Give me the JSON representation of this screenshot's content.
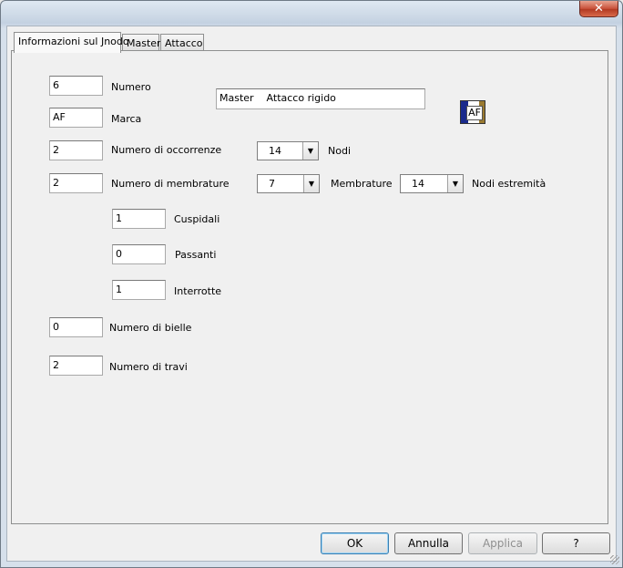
{
  "tabs": [
    "Informazioni sul Jnodo",
    "Master",
    "Attacco"
  ],
  "close_label": "✕",
  "fields": {
    "numero": {
      "value": "6",
      "label": "Numero"
    },
    "marca": {
      "value": "AF",
      "label": "Marca"
    },
    "occorrenze": {
      "value": "2",
      "label": "Numero di occorrenze"
    },
    "membrature": {
      "value": "2",
      "label": "Numero di membrature"
    },
    "cuspidali": {
      "value": "1",
      "label": "Cuspidali"
    },
    "passanti": {
      "value": "0",
      "label": "Passanti"
    },
    "interrotte": {
      "value": "1",
      "label": "Interrotte"
    },
    "bielle": {
      "value": "0",
      "label": "Numero di bielle"
    },
    "travi": {
      "value": "2",
      "label": "Numero di travi"
    }
  },
  "description": "Master    Attacco rigido",
  "icon_text": "AF",
  "combos": {
    "nodi": {
      "value": "14",
      "label": "Nodi"
    },
    "membrature": {
      "value": "7",
      "label": "Membrature"
    },
    "nodi_estremita": {
      "value": "14",
      "label": "Nodi estremità"
    }
  },
  "buttons": {
    "ok": "OK",
    "annulla": "Annulla",
    "applica": "Applica",
    "help": "?"
  },
  "colors": {
    "close_button": "#c8513a",
    "panel": "#f0f0f0"
  }
}
